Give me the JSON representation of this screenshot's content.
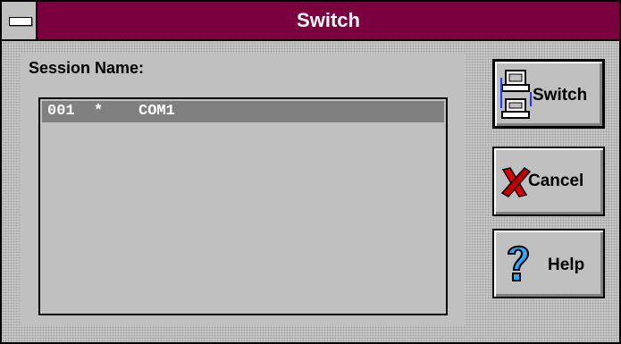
{
  "window": {
    "title": "Switch"
  },
  "session": {
    "label": "Session Name:",
    "rows": [
      {
        "number": "001",
        "marker": "*",
        "name": "COM1"
      }
    ]
  },
  "buttons": {
    "switch": {
      "label": "Switch",
      "icon": "computers-switch-icon"
    },
    "cancel": {
      "label": "Cancel",
      "icon": "red-x-icon"
    },
    "help": {
      "label": "Help",
      "icon": "question-mark-icon"
    }
  },
  "colors": {
    "titlebar": "#7b0040",
    "selection": "#808080",
    "face": "#c0c0c0"
  }
}
